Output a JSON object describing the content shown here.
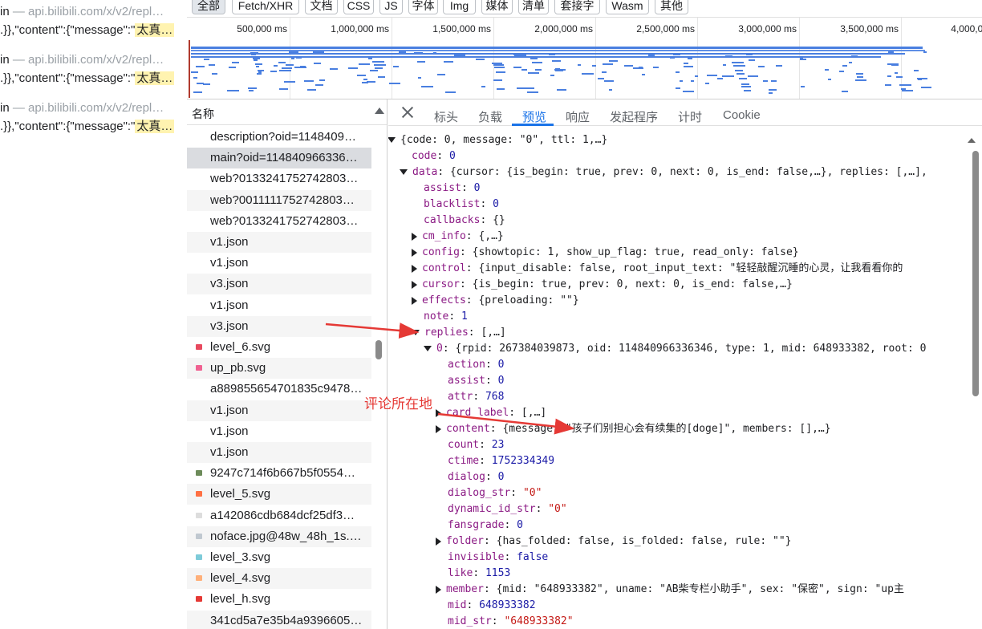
{
  "left_results": [
    {
      "prefix": "in",
      "source": " — api.bilibili.com/x/v2/repl…",
      "snippet": ".}},\"content\":{\"message\":\"",
      "highlight": "太真…"
    },
    {
      "prefix": "in",
      "source": " — api.bilibili.com/x/v2/repl…",
      "snippet": ".}},\"content\":{\"message\":\"",
      "highlight": "太真…"
    },
    {
      "prefix": "in",
      "source": " — api.bilibili.com/x/v2/repl…",
      "snippet": ".}},\"content\":{\"message\":\"",
      "highlight": "太真…"
    }
  ],
  "filters": [
    "全部",
    "Fetch/XHR",
    "文档",
    "CSS",
    "JS",
    "字体",
    "Img",
    "媒体",
    "清单",
    "套接字",
    "Wasm",
    "其他"
  ],
  "active_filter": "全部",
  "timeline_ticks": [
    "500,000 ms",
    "1,000,000 ms",
    "1,500,000 ms",
    "2,000,000 ms",
    "2,500,000 ms",
    "3,000,000 ms",
    "3,500,000 ms",
    "4,000,00"
  ],
  "request_list": {
    "header": "名称",
    "selected_index": 1,
    "items": [
      {
        "name": "description?oid=1148409…",
        "icon_color": ""
      },
      {
        "name": "main?oid=114840966336…",
        "icon_color": ""
      },
      {
        "name": "web?0133241752742803…",
        "icon_color": ""
      },
      {
        "name": "web?0011111752742803…",
        "icon_color": ""
      },
      {
        "name": "web?0133241752742803…",
        "icon_color": ""
      },
      {
        "name": "v1.json",
        "icon_color": ""
      },
      {
        "name": "v1.json",
        "icon_color": ""
      },
      {
        "name": "v3.json",
        "icon_color": ""
      },
      {
        "name": "v1.json",
        "icon_color": ""
      },
      {
        "name": "v3.json",
        "icon_color": ""
      },
      {
        "name": "level_6.svg",
        "icon_color": "#e84a5f"
      },
      {
        "name": "up_pb.svg",
        "icon_color": "#f06292"
      },
      {
        "name": "a889855654701835c9478…",
        "icon_color": ""
      },
      {
        "name": "v1.json",
        "icon_color": ""
      },
      {
        "name": "v1.json",
        "icon_color": ""
      },
      {
        "name": "v1.json",
        "icon_color": ""
      },
      {
        "name": "9247c714f6b667b5f0554…",
        "icon_color": "#6d8b5a"
      },
      {
        "name": "level_5.svg",
        "icon_color": "#ff7043"
      },
      {
        "name": "a142086cdb684dcf25df3…",
        "icon_color": "#dddddd"
      },
      {
        "name": "noface.jpg@48w_48h_1s.…",
        "icon_color": "#c0c8d0"
      },
      {
        "name": "level_3.svg",
        "icon_color": "#7ecbd9"
      },
      {
        "name": "level_4.svg",
        "icon_color": "#ffb07a"
      },
      {
        "name": "level_h.svg",
        "icon_color": "#e53935"
      },
      {
        "name": "341cd5a7e35b4a9396605…",
        "icon_color": ""
      }
    ]
  },
  "detail_tabs": [
    "标头",
    "负载",
    "预览",
    "响应",
    "发起程序",
    "计时",
    "Cookie"
  ],
  "active_tab": "预览",
  "tree": [
    {
      "i": 0,
      "a": "down",
      "parts": [
        [
          "p",
          "{code: 0, message: \"0\", ttl: 1,…}"
        ]
      ]
    },
    {
      "i": 1,
      "a": "",
      "parts": [
        [
          "k",
          "code"
        ],
        [
          "p",
          ": "
        ],
        [
          "n",
          "0"
        ]
      ]
    },
    {
      "i": 1,
      "a": "down",
      "parts": [
        [
          "k",
          "data"
        ],
        [
          "p",
          ": {cursor: {is_begin: true, prev: 0, next: 0, is_end: false,…}, replies: [,…],"
        ]
      ]
    },
    {
      "i": 2,
      "a": "",
      "parts": [
        [
          "k",
          "assist"
        ],
        [
          "p",
          ": "
        ],
        [
          "n",
          "0"
        ]
      ]
    },
    {
      "i": 2,
      "a": "",
      "parts": [
        [
          "k",
          "blacklist"
        ],
        [
          "p",
          ": "
        ],
        [
          "n",
          "0"
        ]
      ]
    },
    {
      "i": 2,
      "a": "",
      "parts": [
        [
          "k",
          "callbacks"
        ],
        [
          "p",
          ": {}"
        ]
      ]
    },
    {
      "i": 2,
      "a": "right",
      "parts": [
        [
          "k",
          "cm_info"
        ],
        [
          "p",
          ": {,…}"
        ]
      ]
    },
    {
      "i": 2,
      "a": "right",
      "parts": [
        [
          "k",
          "config"
        ],
        [
          "p",
          ": {showtopic: 1, show_up_flag: true, read_only: false}"
        ]
      ]
    },
    {
      "i": 2,
      "a": "right",
      "parts": [
        [
          "k",
          "control"
        ],
        [
          "p",
          ": {input_disable: false, root_input_text: \"轻轻敲醒沉睡的心灵，让我看看你的"
        ]
      ]
    },
    {
      "i": 2,
      "a": "right",
      "parts": [
        [
          "k",
          "cursor"
        ],
        [
          "p",
          ": {is_begin: true, prev: 0, next: 0, is_end: false,…}"
        ]
      ]
    },
    {
      "i": 2,
      "a": "right",
      "parts": [
        [
          "k",
          "effects"
        ],
        [
          "p",
          ": {preloading: \"\"}"
        ]
      ]
    },
    {
      "i": 2,
      "a": "",
      "parts": [
        [
          "k",
          "note"
        ],
        [
          "p",
          ": "
        ],
        [
          "n",
          "1"
        ]
      ]
    },
    {
      "i": 2,
      "a": "down",
      "parts": [
        [
          "k",
          "replies"
        ],
        [
          "p",
          ": [,…]"
        ]
      ]
    },
    {
      "i": 3,
      "a": "down",
      "parts": [
        [
          "k",
          "0"
        ],
        [
          "p",
          ": {rpid: 267384039873, oid: 114840966336346, type: 1, mid: 648933382, root: 0"
        ]
      ]
    },
    {
      "i": 4,
      "a": "",
      "parts": [
        [
          "k",
          "action"
        ],
        [
          "p",
          ": "
        ],
        [
          "n",
          "0"
        ]
      ]
    },
    {
      "i": 4,
      "a": "",
      "parts": [
        [
          "k",
          "assist"
        ],
        [
          "p",
          ": "
        ],
        [
          "n",
          "0"
        ]
      ]
    },
    {
      "i": 4,
      "a": "",
      "parts": [
        [
          "k",
          "attr"
        ],
        [
          "p",
          ": "
        ],
        [
          "n",
          "768"
        ]
      ]
    },
    {
      "i": 4,
      "a": "right",
      "parts": [
        [
          "k",
          "card_label"
        ],
        [
          "p",
          ": [,…]"
        ]
      ]
    },
    {
      "i": 4,
      "a": "right",
      "parts": [
        [
          "k",
          "content"
        ],
        [
          "p",
          ": {message: \"孩子们别担心会有续集的[doge]\", members: [],…}"
        ]
      ]
    },
    {
      "i": 4,
      "a": "",
      "parts": [
        [
          "k",
          "count"
        ],
        [
          "p",
          ": "
        ],
        [
          "n",
          "23"
        ]
      ]
    },
    {
      "i": 4,
      "a": "",
      "parts": [
        [
          "k",
          "ctime"
        ],
        [
          "p",
          ": "
        ],
        [
          "n",
          "1752334349"
        ]
      ]
    },
    {
      "i": 4,
      "a": "",
      "parts": [
        [
          "k",
          "dialog"
        ],
        [
          "p",
          ": "
        ],
        [
          "n",
          "0"
        ]
      ]
    },
    {
      "i": 4,
      "a": "",
      "parts": [
        [
          "k",
          "dialog_str"
        ],
        [
          "p",
          ": "
        ],
        [
          "s",
          "\"0\""
        ]
      ]
    },
    {
      "i": 4,
      "a": "",
      "parts": [
        [
          "k",
          "dynamic_id_str"
        ],
        [
          "p",
          ": "
        ],
        [
          "s",
          "\"0\""
        ]
      ]
    },
    {
      "i": 4,
      "a": "",
      "parts": [
        [
          "k",
          "fansgrade"
        ],
        [
          "p",
          ": "
        ],
        [
          "n",
          "0"
        ]
      ]
    },
    {
      "i": 4,
      "a": "right",
      "parts": [
        [
          "k",
          "folder"
        ],
        [
          "p",
          ": {has_folded: false, is_folded: false, rule: \"\"}"
        ]
      ]
    },
    {
      "i": 4,
      "a": "",
      "parts": [
        [
          "k",
          "invisible"
        ],
        [
          "p",
          ": "
        ],
        [
          "b",
          "false"
        ]
      ]
    },
    {
      "i": 4,
      "a": "",
      "parts": [
        [
          "k",
          "like"
        ],
        [
          "p",
          ": "
        ],
        [
          "n",
          "1153"
        ]
      ]
    },
    {
      "i": 4,
      "a": "right",
      "parts": [
        [
          "k",
          "member"
        ],
        [
          "p",
          ": {mid: \"648933382\", uname: \"AB柴专栏小助手\", sex: \"保密\", sign: \"up主"
        ]
      ]
    },
    {
      "i": 4,
      "a": "",
      "parts": [
        [
          "k",
          "mid"
        ],
        [
          "p",
          ": "
        ],
        [
          "n",
          "648933382"
        ]
      ]
    },
    {
      "i": 4,
      "a": "",
      "parts": [
        [
          "k",
          "mid_str"
        ],
        [
          "p",
          ": "
        ],
        [
          "s",
          "\"648933382\""
        ]
      ]
    }
  ],
  "annotation": {
    "label": "评论所在地",
    "color": "#e53935"
  }
}
